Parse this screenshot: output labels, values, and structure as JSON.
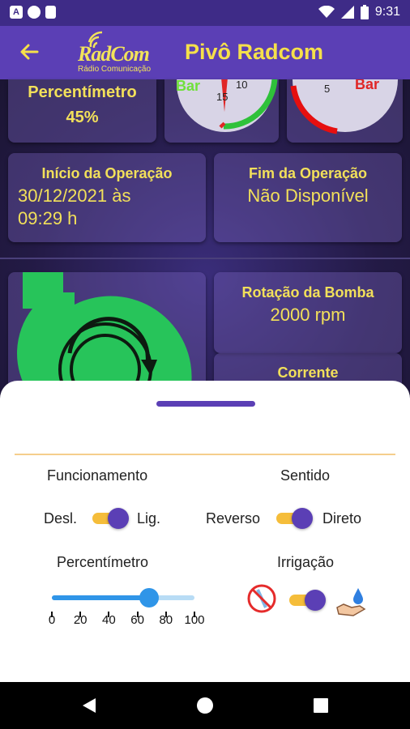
{
  "status_bar": {
    "time": "9:31",
    "left_icons": [
      "a-notification-icon",
      "circle-notification-icon",
      "sd-card-icon"
    ],
    "right_icons": [
      "wifi-icon",
      "signal-icon",
      "battery-icon"
    ]
  },
  "app_bar": {
    "back_icon": "arrow-left-icon",
    "logo_main": "RadCom",
    "logo_sub": "Rádio Comunicação",
    "title": "Pivô Radcom"
  },
  "cards": {
    "percentimeter": {
      "title": "Percentímetro",
      "value": "45%"
    },
    "gauge_left": {
      "label": "Bar",
      "tick_10": "10",
      "tick_15": "15"
    },
    "gauge_right": {
      "label": "Bar",
      "tick_5": "5"
    },
    "start": {
      "title": "Início da Operação",
      "value_line1": "30/12/2021 às",
      "value_line2": "09:29 h"
    },
    "end": {
      "title": "Fim da Operação",
      "value": "Não Disponível"
    },
    "pump_rotation": {
      "title": "Rotação da Bomba",
      "value": "2000 rpm"
    },
    "current": {
      "title": "Corrente"
    }
  },
  "sheet": {
    "operation": {
      "title": "Funcionamento",
      "off_label": "Desl.",
      "on_label": "Lig.",
      "on": true
    },
    "direction": {
      "title": "Sentido",
      "reverse_label": "Reverso",
      "direct_label": "Direto",
      "direct": true
    },
    "percentimeter": {
      "title": "Percentímetro",
      "value": 68,
      "min": 0,
      "max": 100,
      "ticks": [
        "0",
        "20",
        "40",
        "60",
        "80",
        "100"
      ]
    },
    "irrigation": {
      "title": "Irrigação",
      "on": true,
      "off_icon": "no-water-icon",
      "on_icon": "water-hand-icon"
    }
  },
  "nav_bar": {
    "buttons": [
      "back-triangle-icon",
      "home-circle-icon",
      "recents-square-icon"
    ]
  },
  "colors": {
    "primary": "#5b3fb5",
    "status": "#3e2b87",
    "accent": "#f2e05a",
    "switch_track": "#f5bd3a",
    "slider": "#2f95e8",
    "pump_green": "#27c45a"
  }
}
